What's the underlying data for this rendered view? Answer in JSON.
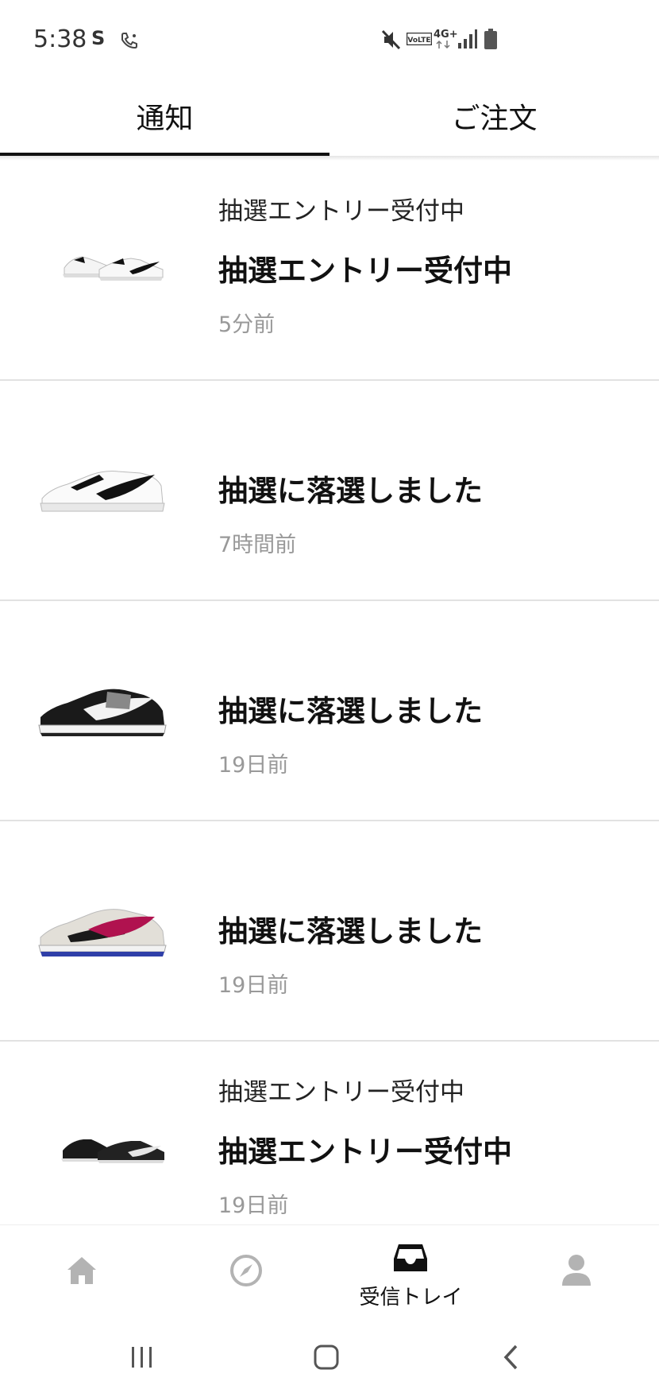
{
  "status_bar": {
    "time": "5:38",
    "left_icons": [
      "s-icon",
      "wifi-call-icon"
    ],
    "right_icons": [
      "mute-icon",
      "volte-icon",
      "4g-icon",
      "signal-icon",
      "battery-icon"
    ],
    "network": "4G+"
  },
  "tabs": [
    {
      "label": "通知",
      "active": true
    },
    {
      "label": "ご注文",
      "active": false
    }
  ],
  "notifications": [
    {
      "subtitle": "抽選エントリー受付中",
      "title": "抽選エントリー受付中",
      "time": "5分前",
      "shoe": "white-black-pair"
    },
    {
      "subtitle": "",
      "title": "抽選に落選しました",
      "time": "7時間前",
      "shoe": "white-black-single"
    },
    {
      "subtitle": "",
      "title": "抽選に落選しました",
      "time": "19日前",
      "shoe": "black-white-single"
    },
    {
      "subtitle": "",
      "title": "抽選に落選しました",
      "time": "19日前",
      "shoe": "grey-pink-blue-single"
    },
    {
      "subtitle": "抽選エントリー受付中",
      "title": "抽選エントリー受付中",
      "time": "19日前",
      "shoe": "black-pair"
    }
  ],
  "bottom_nav": [
    {
      "icon": "home-icon",
      "label": "",
      "active": false
    },
    {
      "icon": "compass-icon",
      "label": "",
      "active": false
    },
    {
      "icon": "inbox-icon",
      "label": "受信トレイ",
      "active": true
    },
    {
      "icon": "profile-icon",
      "label": "",
      "active": false
    }
  ],
  "system_nav": [
    "recent-apps-icon",
    "home-button-icon",
    "back-icon"
  ],
  "colors": {
    "accent": "#111111",
    "muted": "#999999",
    "divider": "#e2e2e2",
    "nav_inactive": "#b3b3b3"
  }
}
